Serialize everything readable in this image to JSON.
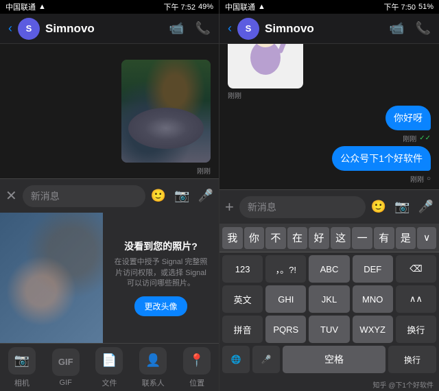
{
  "left": {
    "statusBar": {
      "carrier": "中国联通",
      "wifi": "WiFi",
      "time": "下午 7:52",
      "battery": "49%",
      "carrier2": "中国联通"
    },
    "navTitle": "Simnovo",
    "navInitial": "S",
    "inputPlaceholder": "新消息",
    "msgTimeLabel": "刚刚",
    "noPhotoTitle": "没看到您的照片?",
    "noPhotoDesc": "在设置中授予 Signal 完整照片\n访问权限，或选择 Signal 可以\n访问哪些照片。",
    "noPhotoBtn": "更改头像",
    "mediaActions": [
      {
        "icon": "📷",
        "label": "相机"
      },
      {
        "icon": "GIF",
        "label": "GIF"
      },
      {
        "icon": "📄",
        "label": "文件"
      },
      {
        "icon": "👤",
        "label": "联系人"
      },
      {
        "icon": "📍",
        "label": "位置"
      }
    ]
  },
  "right": {
    "statusBar": {
      "carrier": "中国联通",
      "wifi": "WiFi",
      "time": "下午 7:50",
      "battery": "51%"
    },
    "navTitle": "Simnovo",
    "navInitial": "S",
    "inputPlaceholder": "新消息",
    "stickerTime": "刚刚",
    "bubbles": [
      {
        "text": "你好呀",
        "time": "刚刚",
        "ticks": "✓✓"
      },
      {
        "text": "公众号下1个好软件",
        "time": "刚刚",
        "ticks": "○"
      }
    ],
    "quickWords": [
      "我",
      "你",
      "不",
      "在",
      "好",
      "这",
      "一",
      "有",
      "是"
    ],
    "quickWordMoreLabel": "∨",
    "kbRows": [
      [
        {
          "label": "123",
          "type": "dark"
        },
        {
          "label": "，。?!",
          "type": "dark"
        },
        {
          "label": "ABC",
          "type": "normal"
        },
        {
          "label": "DEF",
          "type": "normal"
        },
        {
          "label": "⌫",
          "type": "dark"
        }
      ],
      [
        {
          "label": "英文",
          "type": "dark"
        },
        {
          "label": "GHI",
          "type": "normal"
        },
        {
          "label": "JKL",
          "type": "normal"
        },
        {
          "label": "MNO",
          "type": "normal"
        },
        {
          "label": "∧∧",
          "type": "dark"
        }
      ],
      [
        {
          "label": "拼音",
          "type": "dark"
        },
        {
          "label": "PQRS",
          "type": "normal"
        },
        {
          "label": "TUV",
          "type": "normal"
        },
        {
          "label": "WXYZ",
          "type": "normal"
        },
        {
          "label": "换行",
          "type": "dark"
        }
      ]
    ],
    "bottomRow": {
      "globe": "🌐",
      "mic": "🎤",
      "space": "空格",
      "switchLabel": "换行"
    },
    "footerText": "知乎 @下1个好软件"
  }
}
